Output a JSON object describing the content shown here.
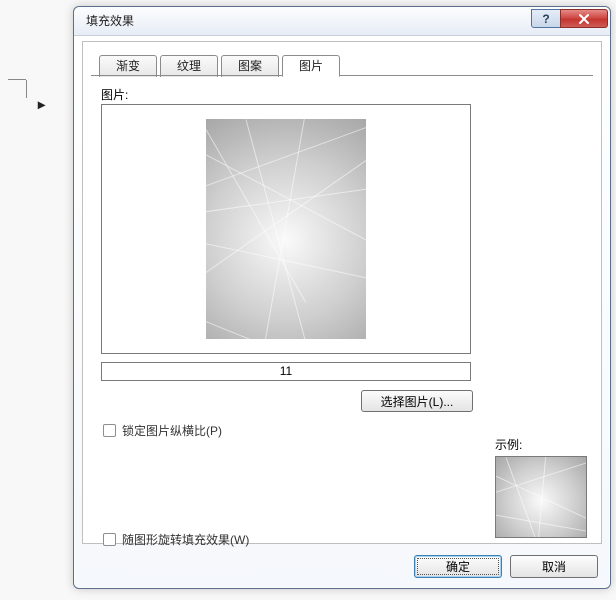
{
  "window": {
    "title": "填充效果"
  },
  "tabs": {
    "gradient": "渐变",
    "texture": "纹理",
    "pattern": "图案",
    "picture": "图片"
  },
  "labels": {
    "picture": "图片:",
    "sample": "示例:"
  },
  "picture": {
    "name": "11"
  },
  "buttons": {
    "select_picture": "选择图片(L)...",
    "ok": "确定",
    "cancel": "取消"
  },
  "checkboxes": {
    "lock_aspect": "锁定图片纵横比(P)",
    "rotate_with_shape": "随图形旋转填充效果(W)"
  },
  "titlebar_icons": {
    "help": "?"
  }
}
